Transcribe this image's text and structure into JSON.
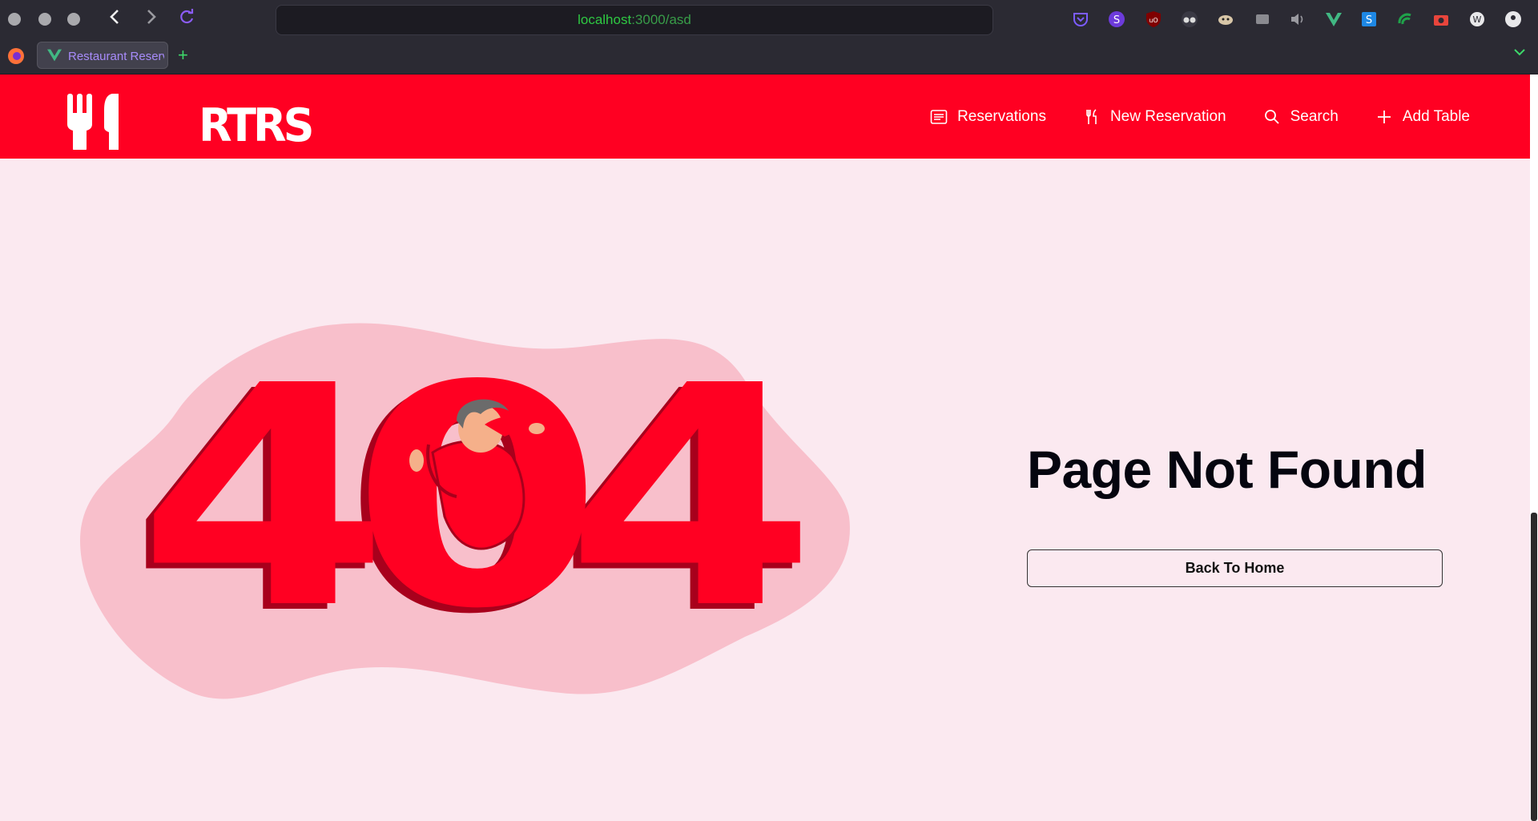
{
  "browser": {
    "url_host": "localhost",
    "url_path": ":3000/asd",
    "tab_title": "Restaurant Reservations",
    "new_tab_symbol": "+",
    "extensions": [
      "pocket-icon",
      "s-extension-icon",
      "ublock-icon",
      "glasses-icon",
      "dog-icon",
      "screen-icon",
      "volume-icon",
      "vue-devtools-icon",
      "s-blue-icon",
      "signal-icon",
      "camera-icon",
      "world-icon",
      "firefox-account-icon"
    ]
  },
  "header": {
    "logo_text": "RTRS",
    "nav": [
      {
        "label": "Reservations",
        "icon": "list-icon"
      },
      {
        "label": "New Reservation",
        "icon": "fork-knife-icon"
      },
      {
        "label": "Search",
        "icon": "search-icon"
      },
      {
        "label": "Add Table",
        "icon": "plus-icon"
      }
    ]
  },
  "main": {
    "illustration_text": "404",
    "title": "Page Not Found",
    "button_label": "Back To Home"
  },
  "colors": {
    "brand_red": "#ff0022",
    "page_bg": "#fbe9f0",
    "blob": "#f8bfcb",
    "dark_red": "#a8001c"
  }
}
